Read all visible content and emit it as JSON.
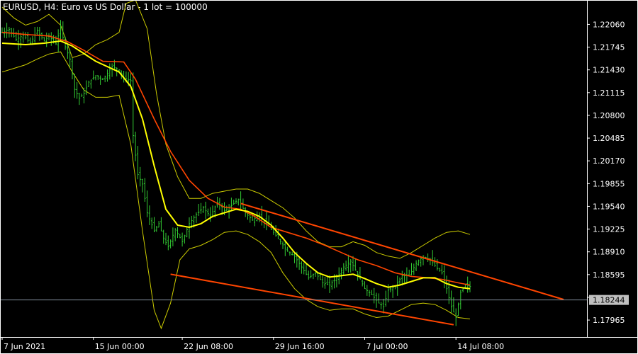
{
  "header": {
    "symbol": "EURUSD",
    "timeframe": "H4",
    "description": "Euro vs US Dollar - 1 lot = 100000",
    "full": "EURUSD, H4:  Euro vs US Dollar - 1 lot = 100000"
  },
  "colors": {
    "background": "#000000",
    "candles": "#33cc33",
    "fast_ma": "#ffff00",
    "slow_ma": "#ff4500",
    "bollinger": "#cccc00",
    "channel": "#ff4500",
    "price_line": "#7f8a99",
    "price_box": "#c0c0c0"
  },
  "current_price": "1.18244",
  "chart_data": {
    "type": "line",
    "instrument": "EURUSD",
    "timeframe": "H4",
    "y_ticks": [
      "1.22060",
      "1.21745",
      "1.21430",
      "1.21115",
      "1.20800",
      "1.20485",
      "1.20170",
      "1.19855",
      "1.19540",
      "1.19225",
      "1.18910",
      "1.18595",
      "1.18280",
      "1.17965"
    ],
    "ylim": [
      1.1775,
      1.2228
    ],
    "x_ticks": [
      "7 Jun 2021",
      "15 Jun 00:00",
      "22 Jun 08:00",
      "29 Jun 16:00",
      "7 Jul 00:00",
      "14 Jul 08:00"
    ],
    "close_path": [
      [
        0,
        1.2195
      ],
      [
        3,
        1.2199
      ],
      [
        6,
        1.2185
      ],
      [
        9,
        1.2191
      ],
      [
        12,
        1.218
      ],
      [
        15,
        1.2197
      ],
      [
        18,
        1.2183
      ],
      [
        20,
        1.219
      ],
      [
        23,
        1.2179
      ],
      [
        25,
        1.2201
      ],
      [
        27,
        1.2175
      ],
      [
        29,
        1.2158
      ],
      [
        31,
        1.2116
      ],
      [
        33,
        1.2104
      ],
      [
        35,
        1.211
      ],
      [
        37,
        1.2126
      ],
      [
        40,
        1.2135
      ],
      [
        43,
        1.213
      ],
      [
        45,
        1.2138
      ],
      [
        47,
        1.2148
      ],
      [
        50,
        1.2143
      ],
      [
        52,
        1.2132
      ],
      [
        55,
        1.2128
      ],
      [
        56,
        1.2052
      ],
      [
        58,
        1.1998
      ],
      [
        60,
        1.1985
      ],
      [
        62,
        1.1945
      ],
      [
        65,
        1.192
      ],
      [
        67,
        1.193
      ],
      [
        69,
        1.191
      ],
      [
        71,
        1.1898
      ],
      [
        74,
        1.1922
      ],
      [
        77,
        1.1905
      ],
      [
        80,
        1.193
      ],
      [
        83,
        1.1943
      ],
      [
        86,
        1.1952
      ],
      [
        89,
        1.194
      ],
      [
        92,
        1.196
      ],
      [
        95,
        1.1948
      ],
      [
        98,
        1.1955
      ],
      [
        101,
        1.1964
      ],
      [
        104,
        1.1945
      ],
      [
        107,
        1.1935
      ],
      [
        110,
        1.1942
      ],
      [
        113,
        1.193
      ],
      [
        116,
        1.1918
      ],
      [
        119,
        1.1905
      ],
      [
        122,
        1.1892
      ],
      [
        125,
        1.1885
      ],
      [
        128,
        1.187
      ],
      [
        131,
        1.1855
      ],
      [
        134,
        1.1862
      ],
      [
        137,
        1.1848
      ],
      [
        140,
        1.1845
      ],
      [
        143,
        1.1855
      ],
      [
        146,
        1.187
      ],
      [
        149,
        1.1878
      ],
      [
        152,
        1.186
      ],
      [
        155,
        1.184
      ],
      [
        158,
        1.1832
      ],
      [
        161,
        1.182
      ],
      [
        163,
        1.1815
      ],
      [
        165,
        1.1838
      ],
      [
        168,
        1.1843
      ],
      [
        171,
        1.1858
      ],
      [
        174,
        1.1858
      ],
      [
        177,
        1.1875
      ],
      [
        180,
        1.1885
      ],
      [
        183,
        1.188
      ],
      [
        186,
        1.1868
      ],
      [
        188,
        1.1862
      ],
      [
        190,
        1.184
      ],
      [
        192,
        1.1815
      ],
      [
        194,
        1.18
      ],
      [
        196,
        1.1835
      ],
      [
        198,
        1.1845
      ],
      [
        200,
        1.1843
      ]
    ],
    "fast_ma": [
      [
        0,
        1.218
      ],
      [
        10,
        1.2178
      ],
      [
        18,
        1.218
      ],
      [
        25,
        1.2183
      ],
      [
        30,
        1.2176
      ],
      [
        40,
        1.2155
      ],
      [
        50,
        1.214
      ],
      [
        55,
        1.212
      ],
      [
        60,
        1.2075
      ],
      [
        65,
        1.201
      ],
      [
        70,
        1.195
      ],
      [
        75,
        1.1928
      ],
      [
        80,
        1.1925
      ],
      [
        85,
        1.193
      ],
      [
        90,
        1.194
      ],
      [
        95,
        1.1945
      ],
      [
        100,
        1.195
      ],
      [
        105,
        1.1947
      ],
      [
        110,
        1.194
      ],
      [
        115,
        1.1928
      ],
      [
        120,
        1.191
      ],
      [
        125,
        1.189
      ],
      [
        130,
        1.1875
      ],
      [
        135,
        1.1862
      ],
      [
        140,
        1.1856
      ],
      [
        145,
        1.1858
      ],
      [
        150,
        1.186
      ],
      [
        155,
        1.1854
      ],
      [
        160,
        1.1847
      ],
      [
        165,
        1.1842
      ],
      [
        170,
        1.1845
      ],
      [
        175,
        1.185
      ],
      [
        180,
        1.1855
      ],
      [
        185,
        1.1855
      ],
      [
        190,
        1.1847
      ],
      [
        195,
        1.1842
      ],
      [
        200,
        1.184
      ]
    ],
    "slow_ma": [
      [
        0,
        1.2195
      ],
      [
        10,
        1.2192
      ],
      [
        20,
        1.219
      ],
      [
        28,
        1.2182
      ],
      [
        35,
        1.217
      ],
      [
        43,
        1.2155
      ],
      [
        52,
        1.2154
      ],
      [
        57,
        1.213
      ],
      [
        65,
        1.2075
      ],
      [
        72,
        1.203
      ],
      [
        80,
        1.199
      ],
      [
        88,
        1.1965
      ],
      [
        95,
        1.1953
      ],
      [
        102,
        1.195
      ],
      [
        108,
        1.194
      ],
      [
        115,
        1.1925
      ],
      [
        122,
        1.1918
      ],
      [
        130,
        1.191
      ],
      [
        138,
        1.19
      ],
      [
        145,
        1.189
      ],
      [
        152,
        1.188
      ],
      [
        160,
        1.1872
      ],
      [
        168,
        1.1862
      ],
      [
        175,
        1.1857
      ],
      [
        182,
        1.1855
      ],
      [
        188,
        1.1853
      ],
      [
        195,
        1.1848
      ],
      [
        200,
        1.1845
      ]
    ],
    "bb_upper": [
      [
        0,
        1.223
      ],
      [
        5,
        1.2215
      ],
      [
        10,
        1.2205
      ],
      [
        15,
        1.221
      ],
      [
        20,
        1.222
      ],
      [
        25,
        1.2205
      ],
      [
        30,
        1.216
      ],
      [
        35,
        1.2165
      ],
      [
        40,
        1.2178
      ],
      [
        45,
        1.2185
      ],
      [
        50,
        1.2195
      ],
      [
        53,
        1.2235
      ],
      [
        57,
        1.224
      ],
      [
        62,
        1.22
      ],
      [
        66,
        1.211
      ],
      [
        70,
        1.204
      ],
      [
        75,
        1.1995
      ],
      [
        80,
        1.1965
      ],
      [
        85,
        1.1965
      ],
      [
        90,
        1.1972
      ],
      [
        95,
        1.1975
      ],
      [
        100,
        1.1978
      ],
      [
        105,
        1.1978
      ],
      [
        110,
        1.1972
      ],
      [
        115,
        1.1962
      ],
      [
        120,
        1.1952
      ],
      [
        125,
        1.1938
      ],
      [
        130,
        1.192
      ],
      [
        135,
        1.1905
      ],
      [
        140,
        1.1898
      ],
      [
        145,
        1.1898
      ],
      [
        150,
        1.1905
      ],
      [
        155,
        1.19
      ],
      [
        160,
        1.189
      ],
      [
        165,
        1.1885
      ],
      [
        170,
        1.1882
      ],
      [
        175,
        1.189
      ],
      [
        180,
        1.19
      ],
      [
        185,
        1.191
      ],
      [
        190,
        1.1918
      ],
      [
        195,
        1.192
      ],
      [
        200,
        1.1915
      ]
    ],
    "bb_lower": [
      [
        0,
        1.214
      ],
      [
        5,
        1.2145
      ],
      [
        10,
        1.215
      ],
      [
        15,
        1.2158
      ],
      [
        20,
        1.2165
      ],
      [
        25,
        1.2168
      ],
      [
        30,
        1.214
      ],
      [
        35,
        1.2115
      ],
      [
        40,
        1.2105
      ],
      [
        45,
        1.2105
      ],
      [
        50,
        1.2108
      ],
      [
        55,
        1.204
      ],
      [
        60,
        1.192
      ],
      [
        65,
        1.181
      ],
      [
        68,
        1.1785
      ],
      [
        72,
        1.182
      ],
      [
        76,
        1.188
      ],
      [
        80,
        1.1895
      ],
      [
        85,
        1.19
      ],
      [
        90,
        1.1908
      ],
      [
        95,
        1.1918
      ],
      [
        100,
        1.192
      ],
      [
        105,
        1.1915
      ],
      [
        110,
        1.1905
      ],
      [
        115,
        1.189
      ],
      [
        120,
        1.1862
      ],
      [
        125,
        1.184
      ],
      [
        130,
        1.1825
      ],
      [
        135,
        1.1815
      ],
      [
        140,
        1.181
      ],
      [
        145,
        1.1812
      ],
      [
        150,
        1.1812
      ],
      [
        155,
        1.1805
      ],
      [
        160,
        1.18
      ],
      [
        165,
        1.1802
      ],
      [
        170,
        1.181
      ],
      [
        175,
        1.1818
      ],
      [
        180,
        1.182
      ],
      [
        185,
        1.1818
      ],
      [
        190,
        1.181
      ],
      [
        195,
        1.18
      ],
      [
        200,
        1.1798
      ]
    ],
    "channel": {
      "upper": [
        [
          102,
          1.1958
        ],
        [
          240,
          1.1825
        ]
      ],
      "lower": [
        [
          72,
          1.186
        ],
        [
          193,
          1.179
        ]
      ]
    },
    "grid": false,
    "legend": "none"
  }
}
